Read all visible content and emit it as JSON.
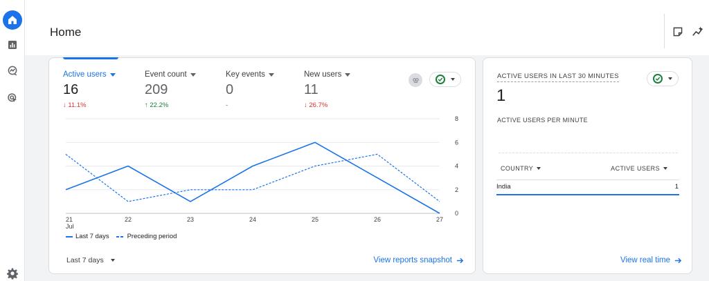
{
  "page": {
    "title": "Home"
  },
  "nav": {
    "items": [
      {
        "name": "home",
        "icon": "home-icon",
        "active": true
      },
      {
        "name": "reports",
        "icon": "bar-chart-icon",
        "active": false
      },
      {
        "name": "explore",
        "icon": "explore-icon",
        "active": false
      },
      {
        "name": "advertising",
        "icon": "advertising-icon",
        "active": false
      }
    ],
    "bottom": {
      "name": "admin",
      "icon": "gear-icon"
    }
  },
  "header": {
    "icons": [
      "customize-note-icon",
      "insights-sparkline-icon"
    ]
  },
  "overview": {
    "metrics": [
      {
        "label": "Active users",
        "value": "16",
        "change": "↓ 11.1%",
        "trend": "down",
        "selected": true
      },
      {
        "label": "Event count",
        "value": "209",
        "change": "↑ 22.2%",
        "trend": "up",
        "selected": false
      },
      {
        "label": "Key events",
        "value": "0",
        "change": "-",
        "trend": "neutral",
        "selected": false
      },
      {
        "label": "New users",
        "value": "11",
        "change": "↓ 26.7%",
        "trend": "down",
        "selected": false
      }
    ],
    "date_range": "Last 7 days",
    "link": "View reports snapshot",
    "legend": {
      "current": "Last 7 days",
      "previous": "Preceding period"
    }
  },
  "chart_data": {
    "type": "line",
    "x": [
      "21",
      "22",
      "23",
      "24",
      "25",
      "26",
      "27"
    ],
    "x_sublabel": "Jul",
    "ylim": [
      0,
      8
    ],
    "yticks": [
      "0",
      "2",
      "4",
      "6",
      "8"
    ],
    "y_axis_side": "right",
    "grid": true,
    "legend_position": "bottom-left",
    "series": [
      {
        "name": "Last 7 days",
        "style": "solid",
        "values": [
          2,
          4,
          1,
          4,
          6,
          3,
          0
        ]
      },
      {
        "name": "Preceding period",
        "style": "dashed",
        "values": [
          5,
          1,
          2,
          2,
          4,
          5,
          1
        ]
      }
    ]
  },
  "realtime": {
    "title": "ACTIVE USERS IN LAST 30 MINUTES",
    "value": "1",
    "subtitle": "ACTIVE USERS PER MINUTE",
    "columns": [
      "COUNTRY",
      "ACTIVE USERS"
    ],
    "rows": [
      {
        "country": "India",
        "users": "1"
      }
    ],
    "link": "View real time"
  },
  "colors": {
    "accent": "#1a73e8",
    "down": "#d93025",
    "up": "#188038"
  }
}
